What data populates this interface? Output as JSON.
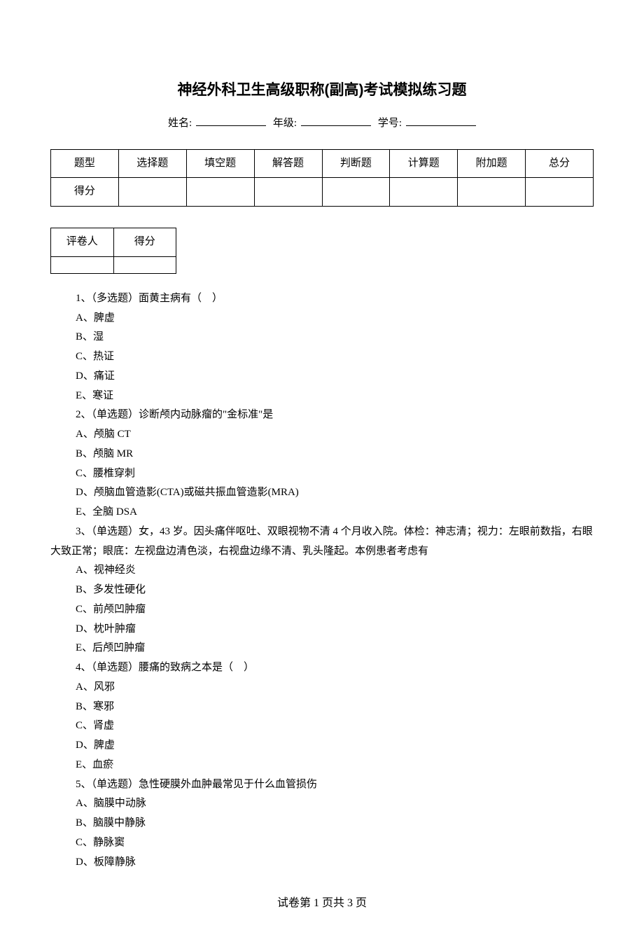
{
  "title": "神经外科卫生高级职称(副高)考试模拟练习题",
  "info": {
    "name_label": "姓名:",
    "grade_label": "年级:",
    "id_label": "学号:"
  },
  "score_table": {
    "headers": [
      "题型",
      "选择题",
      "填空题",
      "解答题",
      "判断题",
      "计算题",
      "附加题",
      "总分"
    ],
    "row_label": "得分"
  },
  "grader_table": {
    "col1": "评卷人",
    "col2": "得分"
  },
  "questions": [
    {
      "stem": "1、（多选题）面黄主病有（　）",
      "options": [
        "A、脾虚",
        "B、湿",
        "C、热证",
        "D、痛证",
        "E、寒证"
      ]
    },
    {
      "stem": "2、（单选题）诊断颅内动脉瘤的\"金标准\"是",
      "options": [
        "A、颅脑 CT",
        "B、颅脑 MR",
        "C、腰椎穿刺",
        "D、颅脑血管造影(CTA)或磁共振血管造影(MRA)",
        "E、全脑 DSA"
      ]
    },
    {
      "stem": "3、（单选题）女，43 岁。因头痛伴呕吐、双眼视物不清 4 个月收入院。体检：神志清；视力：左眼前数指，右眼大致正常；眼底：左视盘边清色淡，右视盘边缘不清、乳头隆起。本例患者考虑有",
      "wrap": true,
      "options": [
        "A、视神经炎",
        "B、多发性硬化",
        "C、前颅凹肿瘤",
        "D、枕叶肿瘤",
        "E、后颅凹肿瘤"
      ]
    },
    {
      "stem": "4、（单选题）腰痛的致病之本是（　）",
      "options": [
        "A、风邪",
        "B、寒邪",
        "C、肾虚",
        "D、脾虚",
        "E、血瘀"
      ]
    },
    {
      "stem": "5、（单选题）急性硬膜外血肿最常见于什么血管损伤",
      "options": [
        "A、脑膜中动脉",
        "B、脑膜中静脉",
        "C、静脉窦",
        "D、板障静脉"
      ]
    }
  ],
  "footer": "试卷第 1 页共 3 页"
}
